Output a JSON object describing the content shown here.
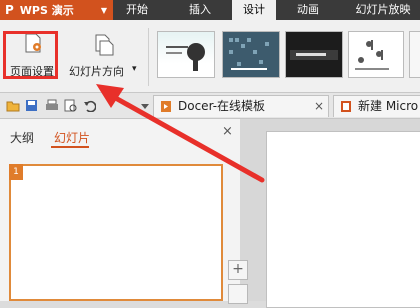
{
  "app": {
    "name": "WPS 演示",
    "logo": "P",
    "dropdown_icon": "caret-down-icon"
  },
  "menu_tabs": [
    "开始",
    "插入",
    "设计",
    "动画",
    "幻灯片放映"
  ],
  "active_menu_tab": "设计",
  "ribbon": {
    "page_setup_label": "页面设置",
    "orientation_label": "幻灯片方向",
    "orientation_caret": "▾",
    "highlight_color": "#e8302a"
  },
  "doc_tabs": [
    {
      "label": "Docer-在线模板",
      "close": "×"
    },
    {
      "label": "新建 Micro"
    }
  ],
  "left_panel": {
    "tabs": [
      "大纲",
      "幻灯片"
    ],
    "active_tab": "幻灯片",
    "close": "×",
    "slide_number": "1"
  },
  "canvas_buttons": [
    "+"
  ],
  "colors": {
    "accent": "#d2521e",
    "annotation_red": "#e8302a"
  }
}
